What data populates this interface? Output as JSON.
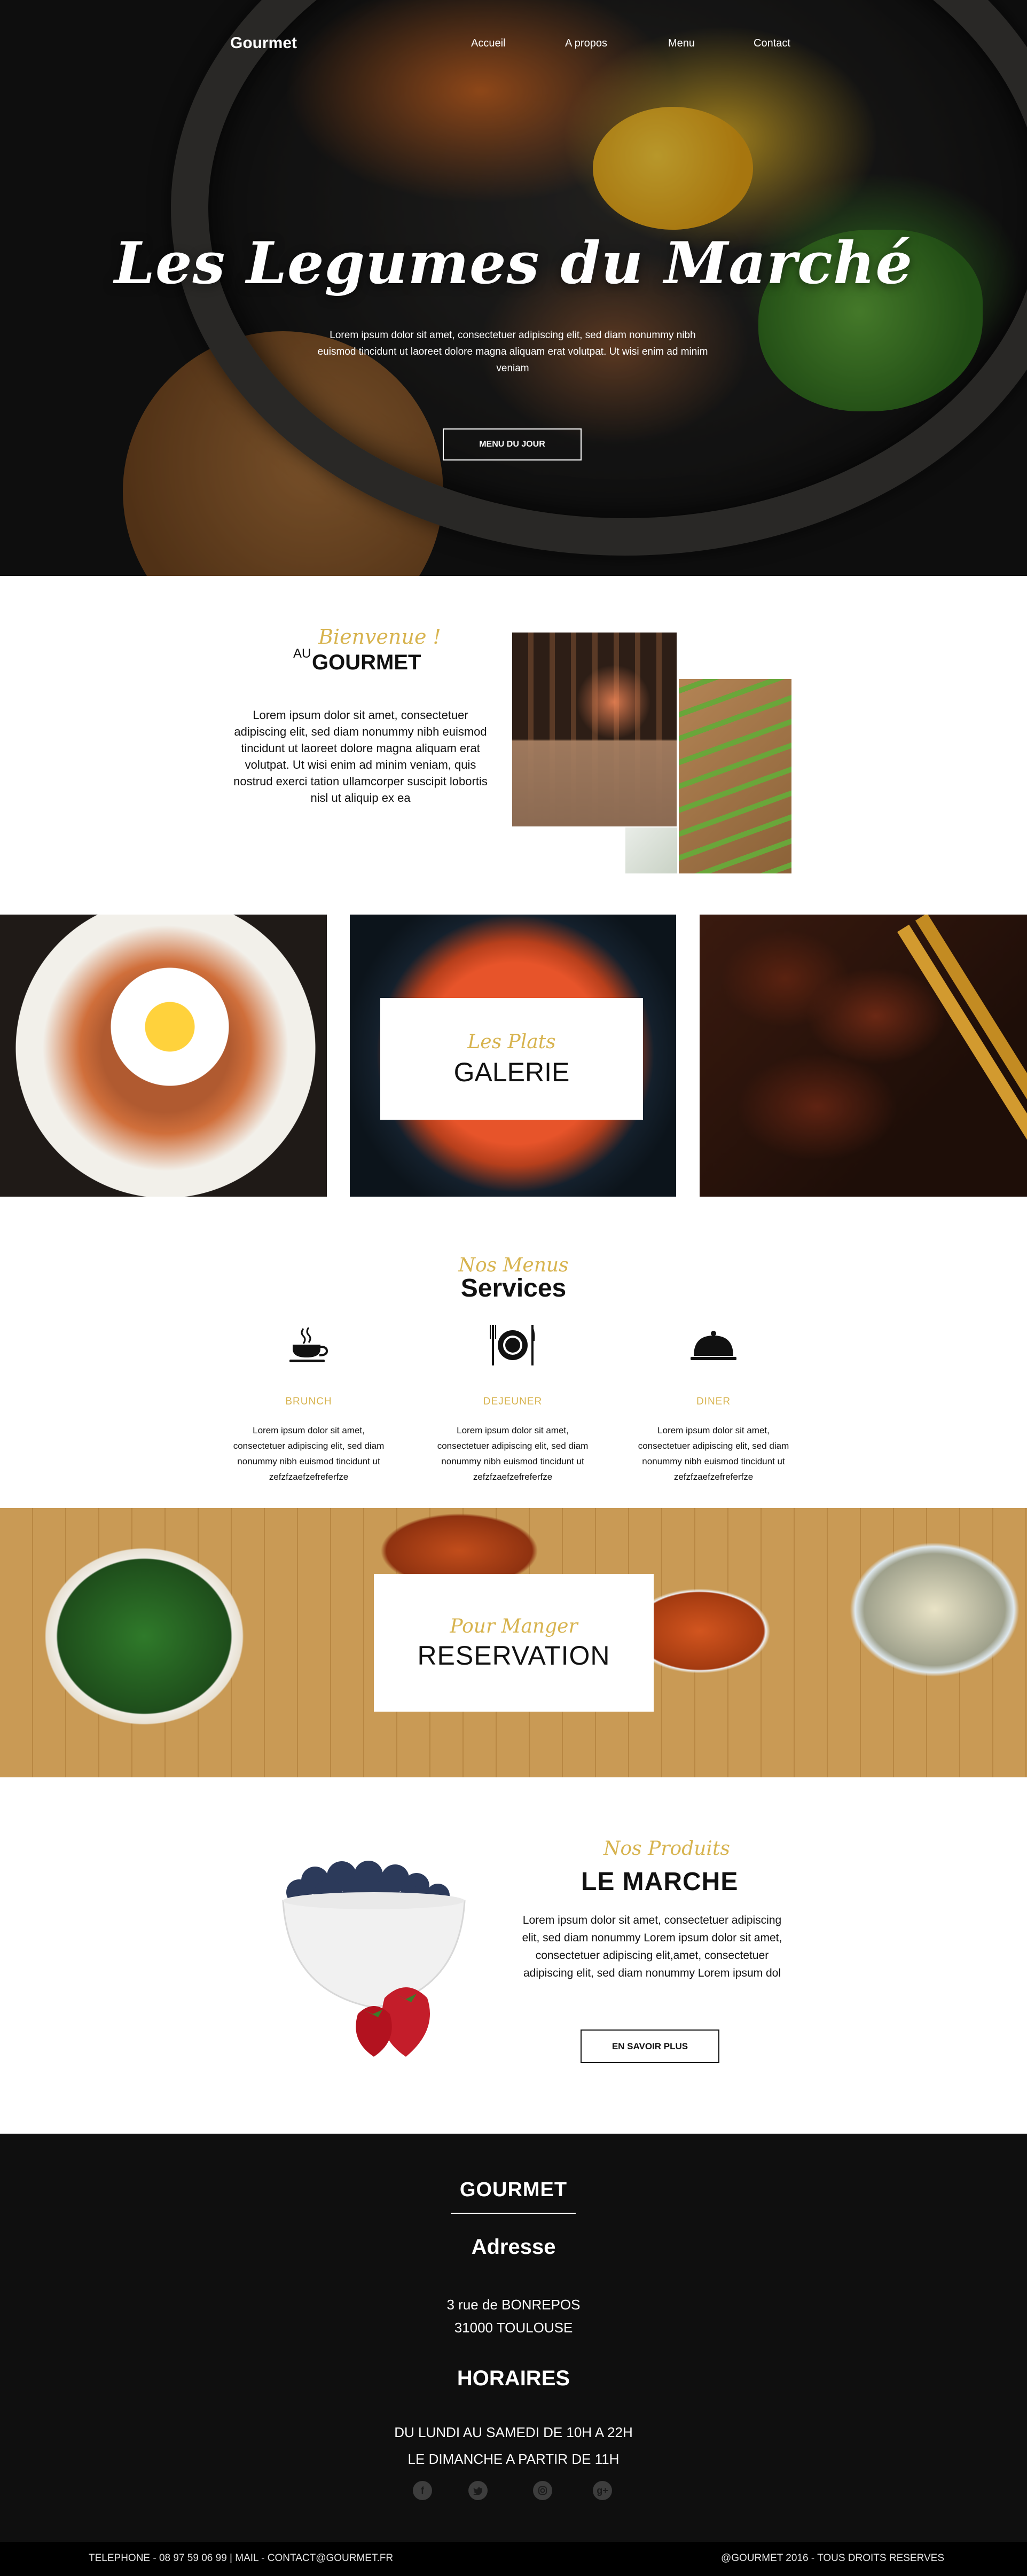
{
  "header": {
    "brand": "Gourmet",
    "nav": [
      "Accueil",
      "A propos",
      "Menu",
      "Contact"
    ]
  },
  "hero": {
    "title": "Les Legumes du Marché",
    "text": "Lorem ipsum dolor sit amet, consectetuer adipiscing elit, sed diam nonummy nibh euismod tincidunt ut laoreet dolore magna aliquam erat volutpat. Ut wisi enim ad minim veniam",
    "button": "MENU DU JOUR"
  },
  "welcome": {
    "script": "Bienvenue !",
    "prefix": "AU",
    "title": "GOURMET",
    "text": "Lorem ipsum dolor sit amet, consectetuer adipiscing elit, sed diam nonummy nibh euismod tincidunt ut laoreet dolore magna aliquam erat volutpat. Ut wisi enim ad minim veniam, quis nostrud exerci tation ullamcorper suscipit lobortis nisl ut aliquip ex ea"
  },
  "gallery": {
    "script": "Les Plats",
    "title": "GALERIE"
  },
  "services": {
    "script": "Nos Menus",
    "title": "Services",
    "items": [
      {
        "label": "BRUNCH",
        "icon": "coffee-cup-icon",
        "text": "Lorem ipsum dolor sit amet, consectetuer adipiscing elit, sed diam nonummy nibh euismod tincidunt ut zefzfzaefzefreferfze"
      },
      {
        "label": "DEJEUNER",
        "icon": "plate-cutlery-icon",
        "text": "Lorem ipsum dolor sit amet, consectetuer adipiscing elit, sed diam nonummy nibh euismod tincidunt ut zefzfzaefzefreferfze"
      },
      {
        "label": "DINER",
        "icon": "cloche-icon",
        "text": "Lorem ipsum dolor sit amet, consectetuer adipiscing elit, sed diam nonummy nibh euismod tincidunt ut zefzfzaefzefreferfze"
      }
    ]
  },
  "reservation": {
    "script": "Pour Manger",
    "title": "RESERVATION"
  },
  "marche": {
    "script": "Nos Produits",
    "title": "LE MARCHE",
    "text": "Lorem ipsum dolor sit amet, consectetuer adipiscing elit, sed diam nonummy Lorem ipsum dolor sit amet, consectetuer adipiscing elit,amet, consectetuer adipiscing elit, sed diam nonummy Lorem ipsum dol",
    "button": "EN SAVOIR PLUS"
  },
  "footer": {
    "brand": "GOURMET",
    "address_title": "Adresse",
    "address_line1": "3 rue de BONREPOS",
    "address_line2": "31000 TOULOUSE",
    "hours_title": "HORAIRES",
    "hours_line1": "DU LUNDI AU SAMEDI DE 10H A 22H",
    "hours_line2": "LE DIMANCHE A PARTIR DE 11H",
    "socials": [
      "facebook-icon",
      "twitter-icon",
      "instagram-icon",
      "google-plus-icon"
    ],
    "bottom_left": "TELEPHONE  - 08 97 59 06 99   |   MAIL - CONTACT@GOURMET.FR",
    "bottom_right": "@GOURMET 2016 - TOUS DROITS RESERVES"
  },
  "colors": {
    "accent_gold": "#d7b34e",
    "footer_bg": "#0f0f0f",
    "text_dark": "#111111"
  }
}
